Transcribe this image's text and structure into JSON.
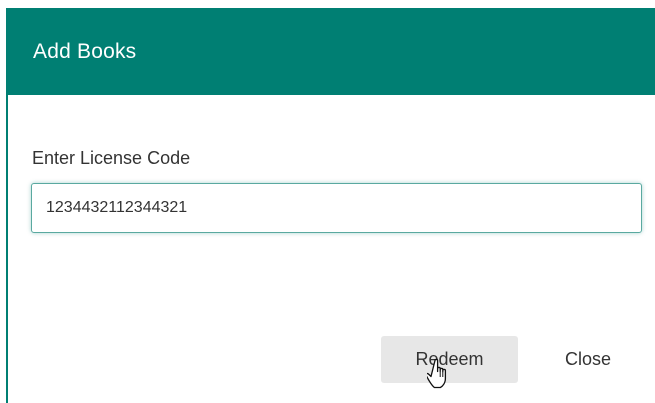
{
  "dialog": {
    "title": "Add Books",
    "field_label": "Enter License Code",
    "license_code_value": "1234432112344321",
    "redeem_label": "Redeem",
    "close_label": "Close"
  },
  "colors": {
    "header_background": "#007f73",
    "header_text": "#ffffff",
    "button_background": "#e7e7e7"
  },
  "icons": {
    "cursor": "hand-cursor-icon"
  }
}
